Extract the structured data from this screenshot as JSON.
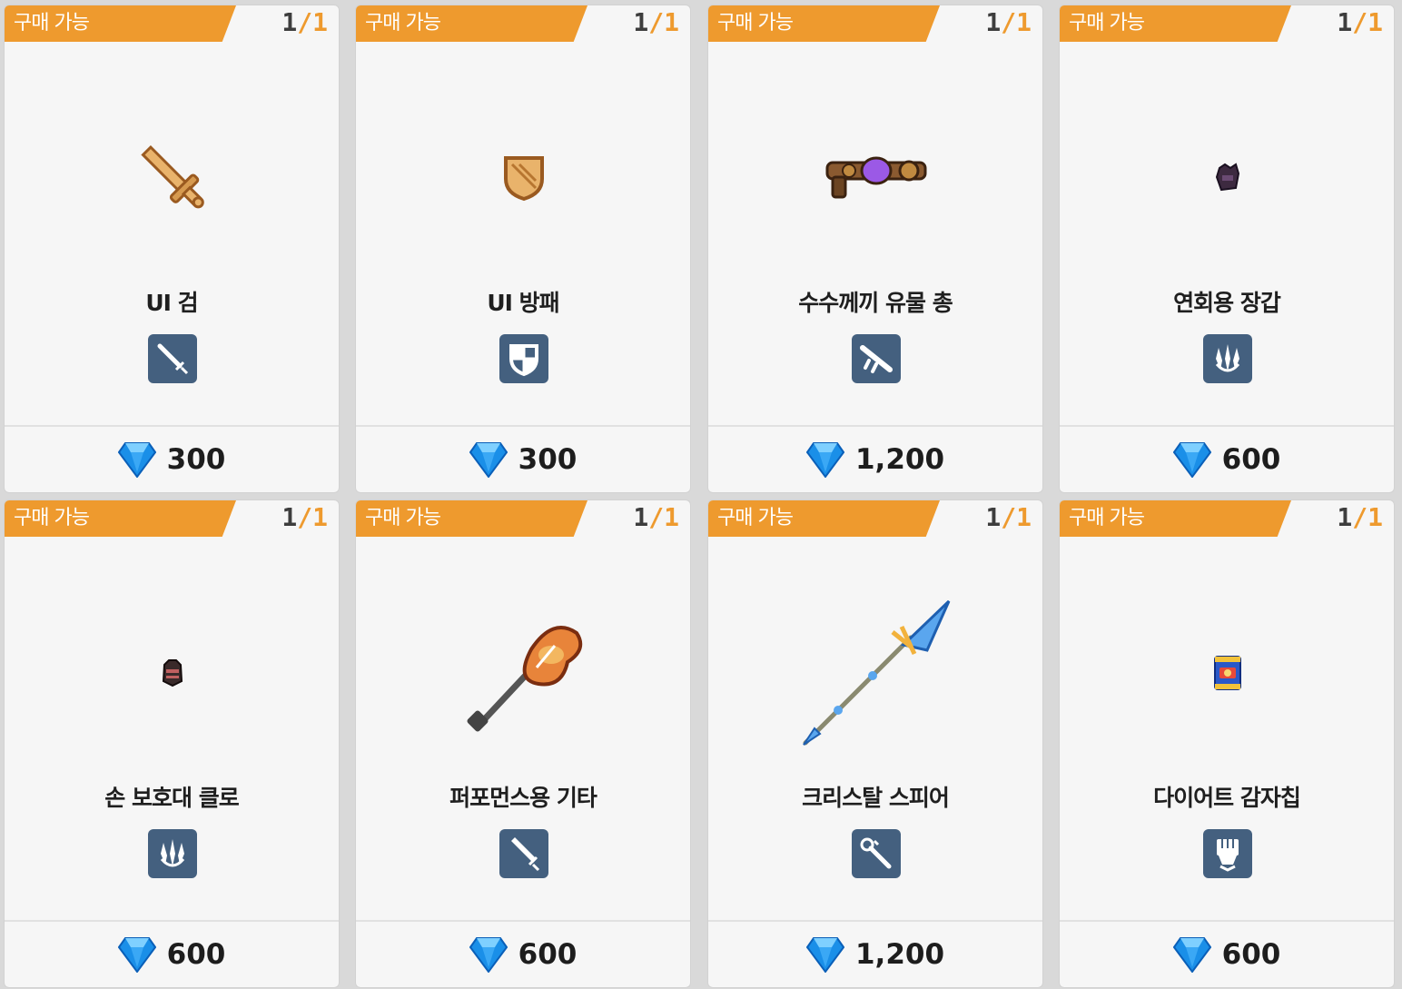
{
  "colors": {
    "badge": "#ee9a2e",
    "type_icon_bg": "#44607f",
    "gem": "#1a8fe8"
  },
  "cards": [
    {
      "badge": "구매 가능",
      "stock_cur": "1",
      "stock_sep": "/",
      "stock_max": "1",
      "name": "UI 검",
      "type_icon": "sword-type-icon",
      "art": "wooden-sword",
      "price": "300"
    },
    {
      "badge": "구매 가능",
      "stock_cur": "1",
      "stock_sep": "/",
      "stock_max": "1",
      "name": "UI 방패",
      "type_icon": "shield-type-icon",
      "art": "wooden-shield",
      "price": "300"
    },
    {
      "badge": "구매 가능",
      "stock_cur": "1",
      "stock_sep": "/",
      "stock_max": "1",
      "name": "수수께끼 유물 총",
      "type_icon": "gun-type-icon",
      "art": "relic-gun",
      "price": "1,200"
    },
    {
      "badge": "구매 가능",
      "stock_cur": "1",
      "stock_sep": "/",
      "stock_max": "1",
      "name": "연회용 장갑",
      "type_icon": "claw-type-icon",
      "art": "banquet-glove",
      "price": "600"
    },
    {
      "badge": "구매 가능",
      "stock_cur": "1",
      "stock_sep": "/",
      "stock_max": "1",
      "name": "손 보호대 클로",
      "type_icon": "claw-type-icon",
      "art": "hand-guard-claw",
      "price": "600"
    },
    {
      "badge": "구매 가능",
      "stock_cur": "1",
      "stock_sep": "/",
      "stock_max": "1",
      "name": "퍼포먼스용 기타",
      "type_icon": "two-handed-sword-type-icon",
      "art": "electric-guitar",
      "price": "600"
    },
    {
      "badge": "구매 가능",
      "stock_cur": "1",
      "stock_sep": "/",
      "stock_max": "1",
      "name": "크리스탈 스피어",
      "type_icon": "staff-type-icon",
      "art": "crystal-spear",
      "price": "1,200"
    },
    {
      "badge": "구매 가능",
      "stock_cur": "1",
      "stock_sep": "/",
      "stock_max": "1",
      "name": "다이어트 감자칩",
      "type_icon": "gauntlet-type-icon",
      "art": "potato-chips",
      "price": "600"
    }
  ]
}
